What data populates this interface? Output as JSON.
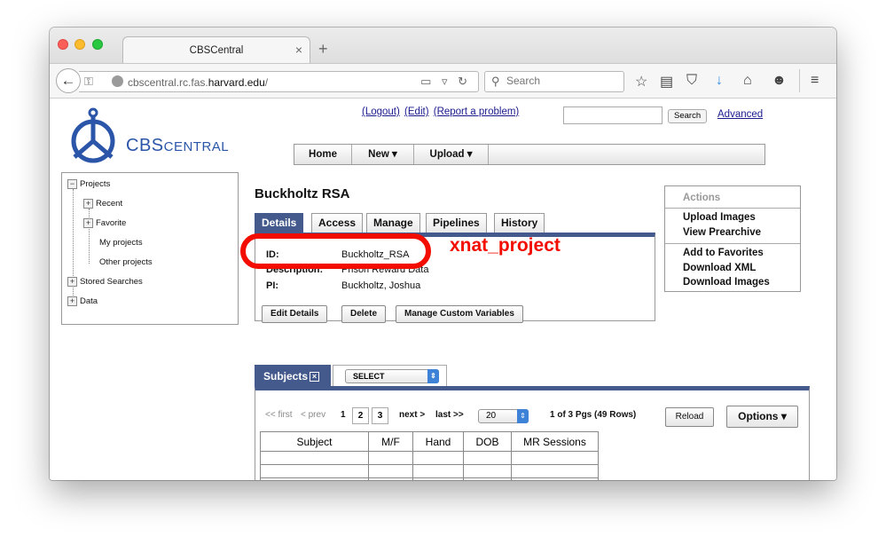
{
  "browser": {
    "tab_title": "CBSCentral",
    "tab_close": "×",
    "new_tab": "+",
    "back": "←",
    "url_host_prefix": "cbscentral.rc.fas.",
    "url_host_domain": "harvard.edu",
    "url_path": "/",
    "search_placeholder": "Search",
    "toolbar_icons": [
      "bookmark-star-icon",
      "reading-list-icon",
      "pocket-icon",
      "download-icon",
      "home-icon",
      "emoji-icon",
      "menu-icon"
    ]
  },
  "site": {
    "logo_cbs": "CBS",
    "logo_central": "Central",
    "links": {
      "logout": "(Logout)",
      "edit": "(Edit)",
      "report": "(Report a problem)"
    },
    "search_button": "Search",
    "advanced": "Advanced",
    "menu": [
      "Home",
      "New",
      "Upload"
    ]
  },
  "tree": {
    "root": "Projects",
    "items": [
      "Recent",
      "Favorite",
      "My projects",
      "Other projects"
    ],
    "stored": "Stored Searches",
    "data": "Data"
  },
  "project": {
    "title": "Buckholtz RSA",
    "tabs": [
      "Details",
      "Access",
      "Manage",
      "Pipelines",
      "History"
    ],
    "fields": {
      "id_label": "ID:",
      "id_value": "Buckholtz_RSA",
      "desc_label": "Description:",
      "desc_value": "Prison Reward Data",
      "pi_label": "PI:",
      "pi_value": "Buckholtz, Joshua"
    },
    "buttons": [
      "Edit Details",
      "Delete",
      "Manage Custom Variables"
    ],
    "callout": "xnat_project",
    "highlight_color": "#f20d00"
  },
  "actions": {
    "title": "Actions",
    "group1": [
      "Upload Images",
      "View Prearchive"
    ],
    "group2": [
      "Add to Favorites",
      "Download XML",
      "Download Images"
    ]
  },
  "subjects": {
    "tab_label": "Subjects",
    "close_glyph": "×",
    "select_label": "SELECT",
    "pager": {
      "first": "<< first",
      "prev": "< prev",
      "p1": "1",
      "p2": "2",
      "p3": "3",
      "next": "next >",
      "last": "last >>"
    },
    "rows_value": "20",
    "page_info": "1 of 3 Pgs (49 Rows)",
    "reload": "Reload",
    "options": "Options ▾",
    "columns": [
      "Subject",
      "M/F",
      "Hand",
      "DOB",
      "MR Sessions"
    ]
  },
  "colors": {
    "accent": "#44598c",
    "link": "#1a1a8e",
    "logo": "#2a55a8"
  }
}
